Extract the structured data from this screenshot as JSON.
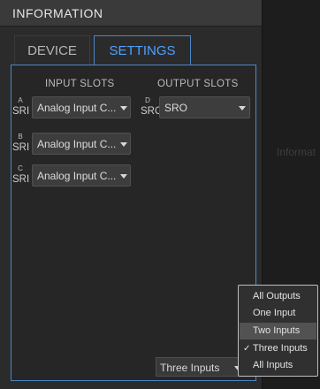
{
  "panel": {
    "title": "INFORMATION"
  },
  "tabs": [
    {
      "label": "DEVICE"
    },
    {
      "label": "SETTINGS"
    }
  ],
  "columns": {
    "input": "INPUT SLOTS",
    "output": "OUTPUT SLOTS"
  },
  "input_slots": [
    {
      "letter": "A",
      "type": "SRI",
      "value": "Analog Input C..."
    },
    {
      "letter": "B",
      "type": "SRI",
      "value": "Analog Input C..."
    },
    {
      "letter": "C",
      "type": "SRI",
      "value": "Analog Input C..."
    }
  ],
  "output_slots": [
    {
      "letter": "D",
      "type": "SRO",
      "value": "SRO"
    }
  ],
  "bottom_select": {
    "value": "Three Inputs"
  },
  "right_panel": {
    "label": "Informat"
  },
  "dropdown_menu": {
    "items": [
      {
        "label": "All Outputs",
        "checked": false
      },
      {
        "label": "One Input",
        "checked": false
      },
      {
        "label": "Two Inputs",
        "checked": false
      },
      {
        "label": "Three Inputs",
        "checked": true
      },
      {
        "label": "All Inputs",
        "checked": false
      }
    ],
    "check_glyph": "✓"
  },
  "colors": {
    "accent": "#4fa0ff",
    "panel_bg": "#2b2b2b",
    "border_accent": "#4f86c7"
  }
}
